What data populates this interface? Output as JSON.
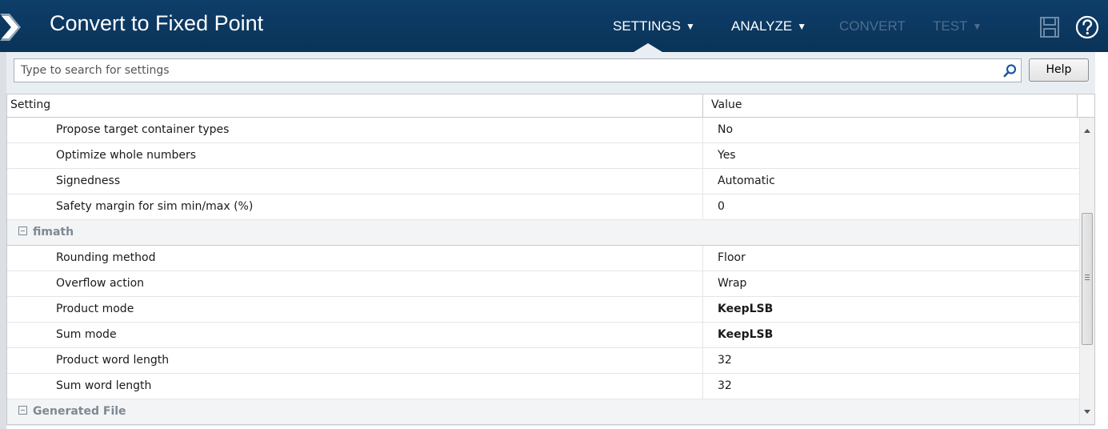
{
  "app": {
    "title": "Convert to Fixed Point",
    "colors": {
      "titlebar": "#0e3e6a",
      "panel": "#e9eef3",
      "group_text": "#7d8994"
    }
  },
  "menu": [
    {
      "label": "SETTINGS",
      "caret": "▼",
      "enabled": true
    },
    {
      "label": "ANALYZE",
      "caret": "▼",
      "enabled": true
    },
    {
      "label": "CONVERT",
      "caret": "",
      "enabled": false
    },
    {
      "label": "TEST",
      "caret": "▼",
      "enabled": false
    }
  ],
  "icons": {
    "left": "chevron-right-icon",
    "save": "save-icon",
    "help": "help-circle-icon",
    "search": "search-icon"
  },
  "search": {
    "placeholder": "Type to search for settings",
    "value": ""
  },
  "help_button": {
    "label": "Help"
  },
  "table": {
    "columns": {
      "setting": "Setting",
      "value": "Value"
    },
    "rows": [
      {
        "type": "item",
        "name": "Propose target container types",
        "value": "No",
        "bold": false
      },
      {
        "type": "item",
        "name": "Optimize whole numbers",
        "value": "Yes",
        "bold": false
      },
      {
        "type": "item",
        "name": "Signedness",
        "value": "Automatic",
        "bold": false
      },
      {
        "type": "item",
        "name": "Safety margin for sim min/max (%)",
        "value": "0",
        "bold": false
      },
      {
        "type": "group",
        "name": "fimath",
        "expanded": true
      },
      {
        "type": "item",
        "name": "Rounding method",
        "value": "Floor",
        "bold": false
      },
      {
        "type": "item",
        "name": "Overflow action",
        "value": "Wrap",
        "bold": false
      },
      {
        "type": "item",
        "name": "Product mode",
        "value": "KeepLSB",
        "bold": true
      },
      {
        "type": "item",
        "name": "Sum mode",
        "value": "KeepLSB",
        "bold": true
      },
      {
        "type": "item",
        "name": "Product word length",
        "value": "32",
        "bold": false
      },
      {
        "type": "item",
        "name": "Sum word length",
        "value": "32",
        "bold": false
      },
      {
        "type": "group",
        "name": "Generated File",
        "expanded": true
      }
    ]
  }
}
